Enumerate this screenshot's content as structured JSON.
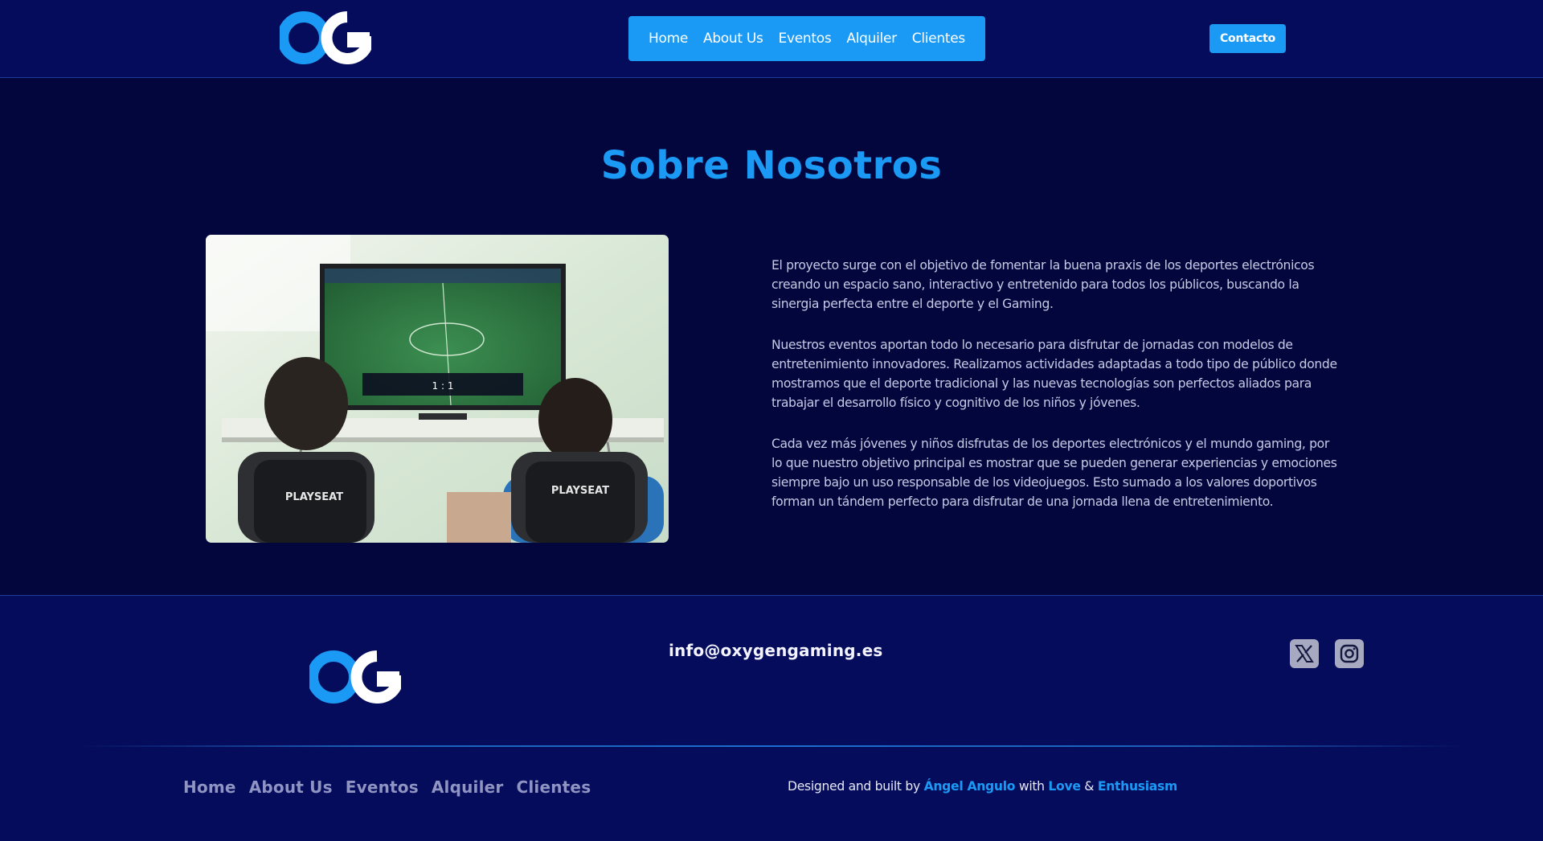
{
  "header": {
    "logo_alt": "OG",
    "nav": [
      "Home",
      "About Us",
      "Eventos",
      "Alquiler",
      "Clientes"
    ],
    "contact_label": "Contacto"
  },
  "main": {
    "title": "Sobre Nosotros",
    "photo_icon": "gaming-photo",
    "paragraphs": [
      "El proyecto surge con el objetivo de fomentar la buena praxis de los deportes electrónicos creando un espacio sano, interactivo y entretenido para todos los públicos, buscando la sinergia perfecta entre el deporte y el Gaming.",
      "Nuestros eventos aportan todo lo necesario para disfrutar de jornadas con modelos de entretenimiento innovadores. Realizamos actividades adaptadas a todo tipo de público donde mostramos que el deporte tradicional y las nuevas tecnologías son perfectos aliados para trabajar el desarrollo físico y cognitivo de los niños y jóvenes.",
      "Cada vez más jóvenes y niños disfrutas de los deportes electrónicos y el mundo gaming, por lo que nuestro objetivo principal es mostrar que se pueden generar experiencias y emociones siempre bajo un uso responsable de los videojuegos. Esto sumado a los valores doportivos forman un tándem perfecto para disfrutar de una jornada llena de entretenimiento."
    ]
  },
  "footer": {
    "email": "info@oxygengaming.es",
    "social_icons": [
      "x-icon",
      "instagram-icon"
    ],
    "nav": [
      "Home",
      "About Us",
      "Eventos",
      "Alquiler",
      "Clientes"
    ],
    "credits": {
      "prefix": "Designed and built by",
      "author": "Ángel Angulo",
      "with": "with",
      "love": "Love",
      "amp": "&",
      "enthusiasm": "Enthusiasm"
    }
  },
  "colors": {
    "accent": "#1b9af5",
    "header_bg": "#050c5c",
    "page_bg": "#03063d"
  }
}
